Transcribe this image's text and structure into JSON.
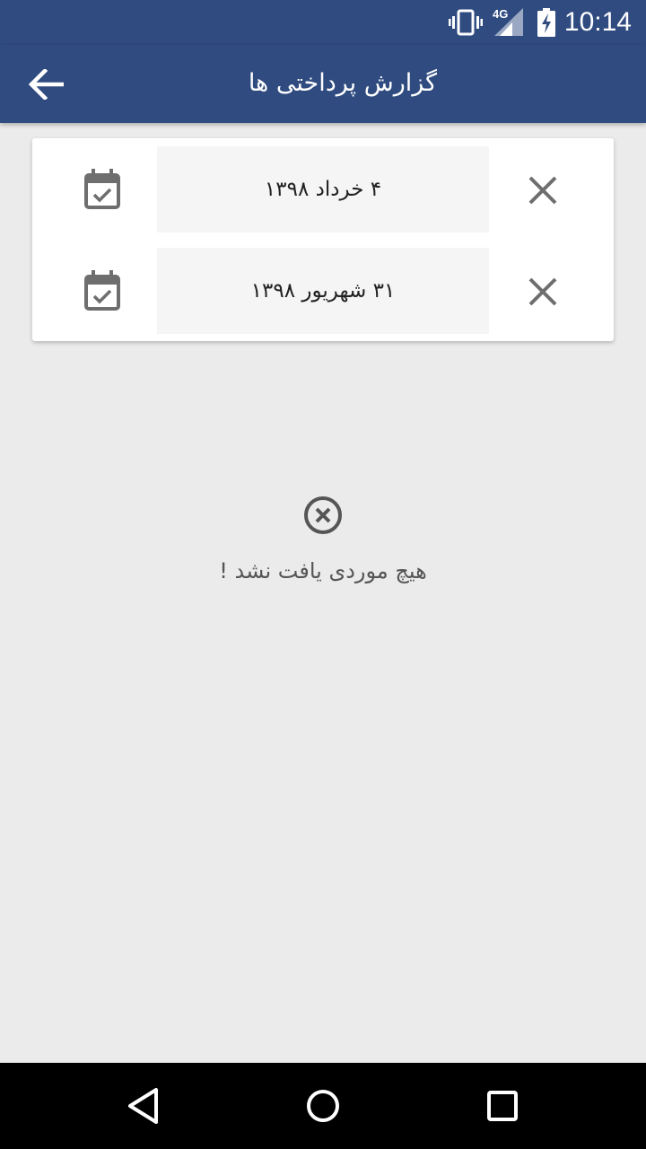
{
  "status_bar": {
    "time": "10:14",
    "network": "4G",
    "icons": [
      "vibrate-icon",
      "signal-icon",
      "battery-charging-icon"
    ]
  },
  "app_bar": {
    "title": "گزارش پرداختی ها",
    "back_icon": "arrow-left-icon"
  },
  "filters": {
    "from_date": "۴ خرداد ۱۳۹۸",
    "to_date": "۳۱ شهریور ۱۳۹۸",
    "calendar_icon": "calendar-check-icon",
    "clear_icon": "close-icon"
  },
  "empty_state": {
    "icon": "circle-x-icon",
    "message": "هیچ موردی یافت نشد !"
  },
  "nav_bar": {
    "icons": [
      "back-triangle-icon",
      "home-circle-icon",
      "recents-square-icon"
    ]
  },
  "colors": {
    "primary": "#2f4b80",
    "background": "#ebebeb",
    "icon_gray": "#6e6e6e"
  }
}
